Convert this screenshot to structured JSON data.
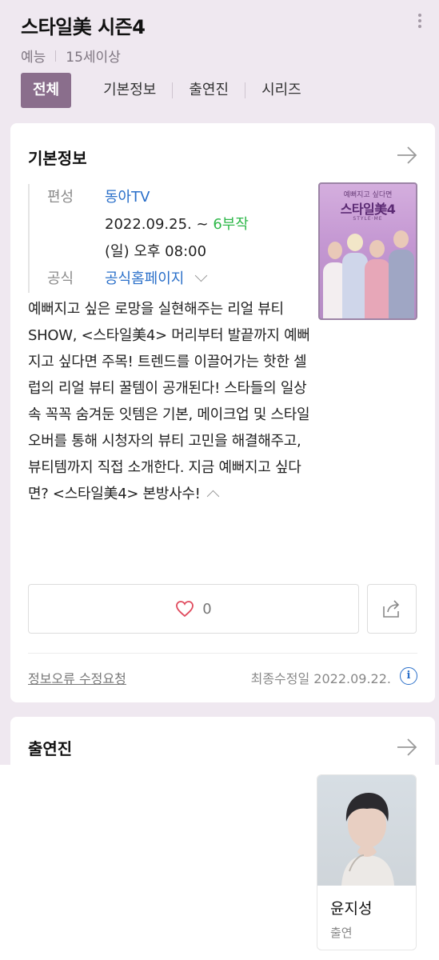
{
  "header": {
    "title": "스타일美 시즌4",
    "genre": "예능",
    "rating": "15세이상",
    "tabs": [
      "전체",
      "기본정보",
      "출연진",
      "시리즈"
    ]
  },
  "basic_info": {
    "section_title": "기본정보",
    "channel_label": "편성",
    "channel": "동아TV",
    "date": "2022.09.25. ~",
    "episodes": "6부작",
    "airtime": "(일) 오후 08:00",
    "official_label": "공식",
    "official_link": "공식홈페이지",
    "description": "예뻐지고 싶은 로망을 실현해주는 리얼 뷰티 SHOW, <스타일美4> 머리부터 발끝까지 예뻐지고 싶다면 주목! 트렌드를 이끌어가는 핫한 셀럽의 리얼 뷰티 꿀템이 공개된다! 스타들의 일상 속 꼭꼭 숨겨둔 잇템은 기본, 메이크업 및 스타일 오버를 통해 시청자의 뷰티 고민을 해결해주고, 뷰티템까지 직접 소개한다. 지금 예뻐지고 싶다면? <스타일美4> 본방사수!",
    "like_count": "0",
    "report_link": "정보오류 수정요청",
    "last_updated": "최종수정일 2022.09.22.",
    "poster": {
      "subtitle": "예뻐지고 싶다면",
      "title": "스타일美4",
      "tagline": "STYLE·ME"
    }
  },
  "cast": {
    "section_title": "출연진",
    "members": [
      {
        "name": "윤지성",
        "role": "출연"
      }
    ]
  },
  "colors": {
    "accent": "#8a6e8c",
    "link": "#2a6fc9",
    "highlight": "#2fb84a",
    "heart": "#e04b5e"
  }
}
